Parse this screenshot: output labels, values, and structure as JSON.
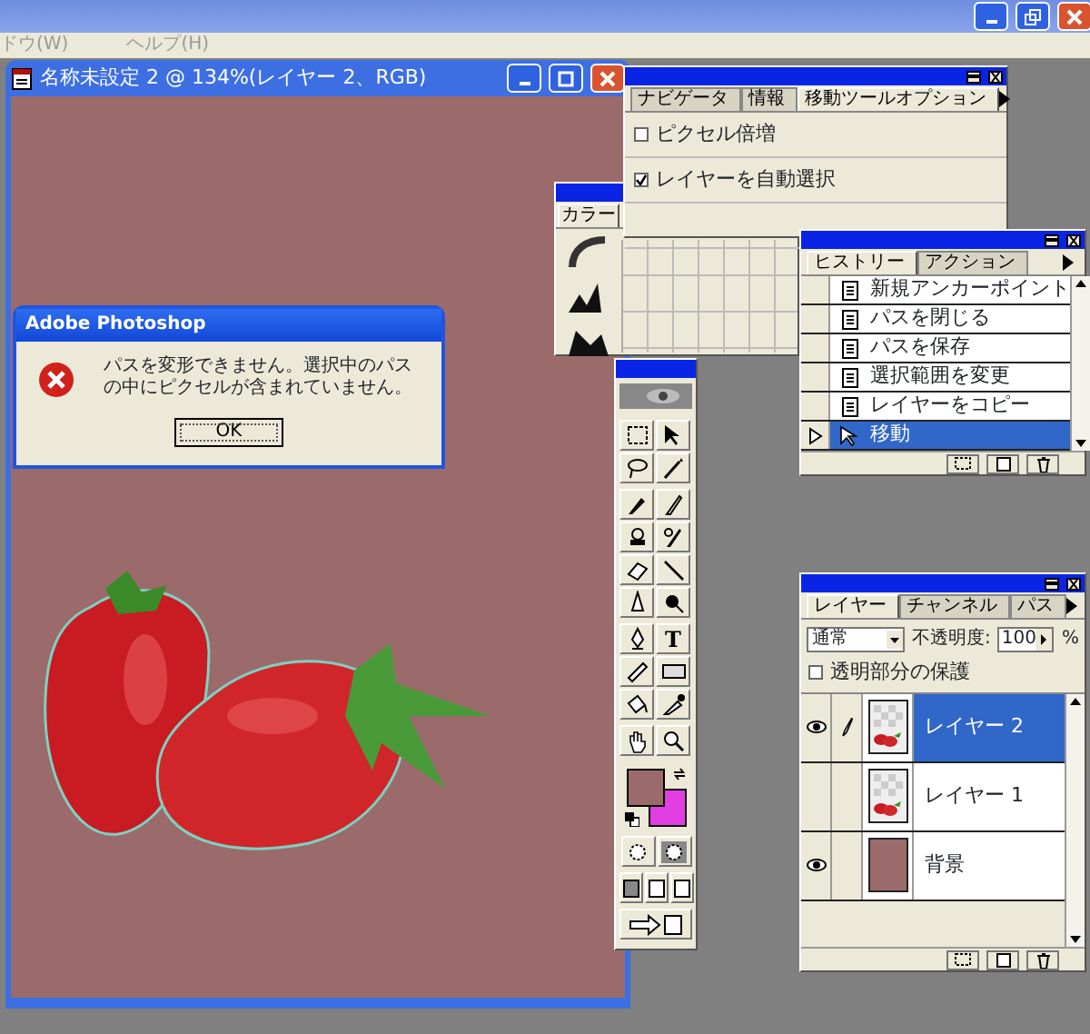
{
  "menu_bar": {
    "items": [
      {
        "label": "ドウ(W)"
      },
      {
        "label": "ヘルプ(H)"
      }
    ]
  },
  "document": {
    "title": "名称未設定 2 @ 134%(レイヤー 2、RGB)"
  },
  "options_panel": {
    "tabs": [
      {
        "label": "ナビゲータ",
        "selected": false
      },
      {
        "label": "情報",
        "selected": false
      },
      {
        "label": "移動ツールオプション",
        "selected": true
      }
    ],
    "options": [
      {
        "label": "ピクセル倍増",
        "checked": false
      },
      {
        "label": "レイヤーを自動選択",
        "checked": true
      }
    ]
  },
  "color_panel": {
    "tabs": [
      {
        "label": "カラー",
        "selected": true
      }
    ]
  },
  "toolbox": {
    "type_tool_label": "T"
  },
  "history_panel": {
    "tabs": [
      {
        "label": "ヒストリー",
        "selected": true
      },
      {
        "label": "アクション",
        "selected": false
      }
    ],
    "items": [
      {
        "label": "新規アンカーポイント",
        "kind": "document",
        "selected": false
      },
      {
        "label": "パスを閉じる",
        "kind": "document",
        "selected": false
      },
      {
        "label": "パスを保存",
        "kind": "document",
        "selected": false
      },
      {
        "label": "選択範囲を変更",
        "kind": "document",
        "selected": false
      },
      {
        "label": "レイヤーをコピー",
        "kind": "document",
        "selected": false
      },
      {
        "label": "移動",
        "kind": "move",
        "selected": true
      }
    ]
  },
  "layers_panel": {
    "tabs": [
      {
        "label": "レイヤー",
        "selected": true
      },
      {
        "label": "チャンネル",
        "selected": false
      },
      {
        "label": "パス",
        "selected": false
      }
    ],
    "blend_mode": "通常",
    "opacity_label": "不透明度:",
    "opacity": "100",
    "opacity_unit": "%",
    "preserve_transparency": {
      "label": "透明部分の保護",
      "checked": false
    },
    "layers": [
      {
        "name": "レイヤー 2",
        "visible": true,
        "editing": true,
        "selected": true,
        "kind": "image"
      },
      {
        "name": "レイヤー 1",
        "visible": false,
        "editing": false,
        "selected": false,
        "kind": "image"
      },
      {
        "name": "背景",
        "visible": true,
        "editing": false,
        "selected": false,
        "kind": "fill"
      }
    ]
  },
  "dialog": {
    "title": "Adobe Photoshop",
    "message": "パスを変形できません。選択中のパスの中にピクセルが含まれていません。",
    "button": "OK"
  }
}
